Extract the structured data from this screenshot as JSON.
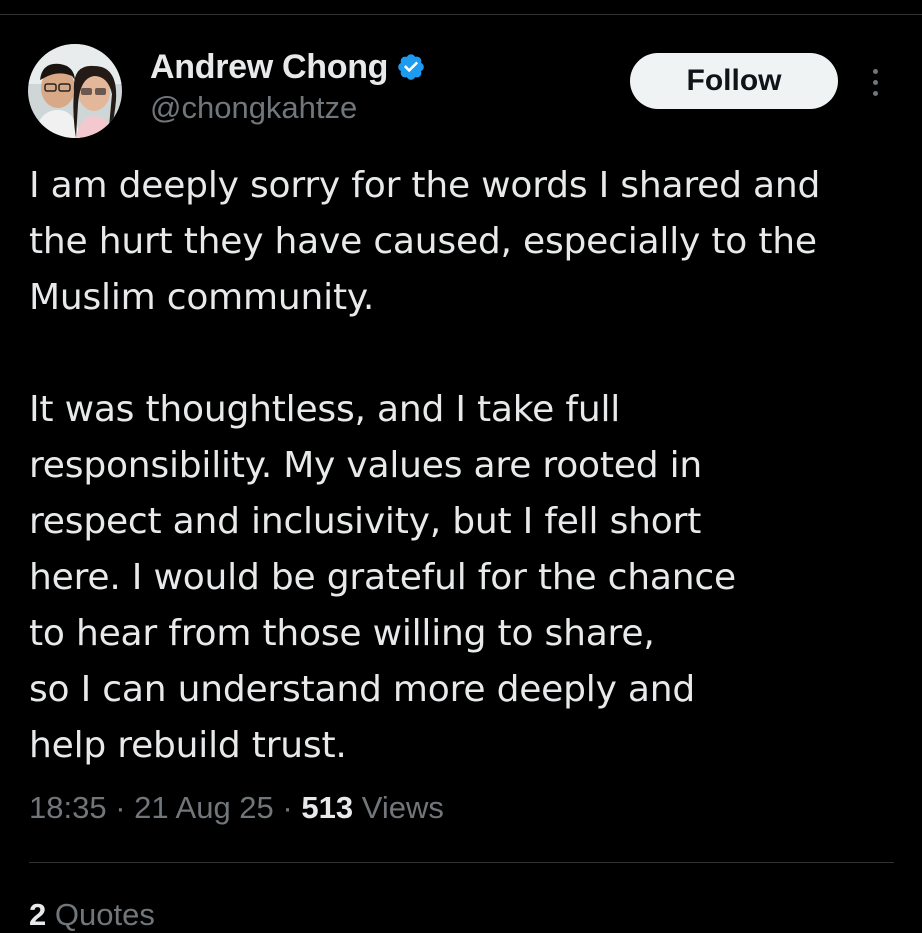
{
  "author": {
    "display_name": "Andrew Chong",
    "handle": "@chongkahtze",
    "verified_icon": "verified-badge-icon"
  },
  "actions": {
    "follow_label": "Follow",
    "more_icon": "more-vertical-icon"
  },
  "tweet": {
    "paragraph1": [
      "I am deeply sorry for the words I shared and",
      "the hurt they have caused, especially to the",
      "Muslim community."
    ],
    "paragraph2": [
      "It was thoughtless, and I take full",
      "responsibility. My values are rooted in",
      "respect and inclusivity, but I fell short",
      "here. I would be grateful for the chance",
      "to hear from those willing to share,",
      "so I can understand more deeply and",
      "help rebuild trust."
    ]
  },
  "meta": {
    "time": "18:35",
    "separator": "·",
    "date": "21 Aug 25",
    "views_count": "513",
    "views_label": "Views"
  },
  "stats": {
    "quotes_count": "2",
    "quotes_label": "Quotes"
  },
  "colors": {
    "background": "#000000",
    "text_primary": "#e7e9ea",
    "text_secondary": "#71767b",
    "verified_blue": "#1d9bf0",
    "follow_bg": "#eff3f4"
  }
}
